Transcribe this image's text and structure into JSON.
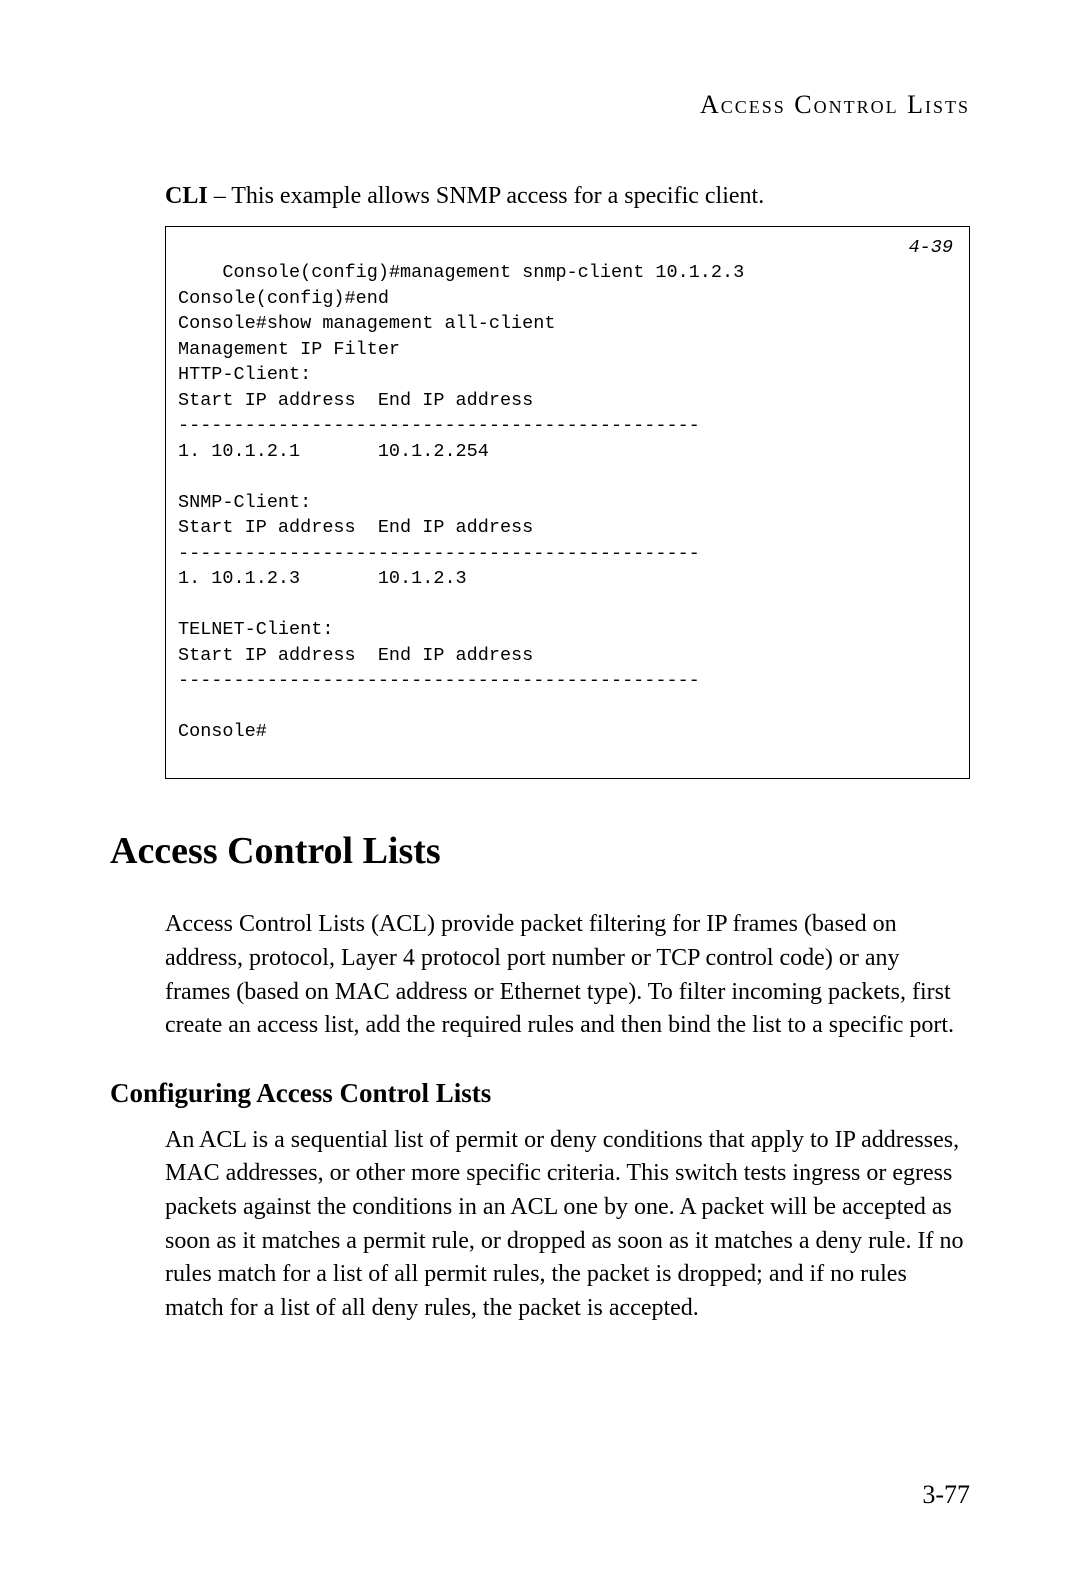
{
  "running_header": "Access Control Lists",
  "intro": {
    "label": "CLI",
    "text": " – This example allows SNMP access for a specific client."
  },
  "code_block": {
    "ref": "4-39",
    "text": "Console(config)#management snmp-client 10.1.2.3\nConsole(config)#end\nConsole#show management all-client\nManagement IP Filter\nHTTP-Client:\nStart IP address  End IP address\n-----------------------------------------------\n1. 10.1.2.1       10.1.2.254\n\nSNMP-Client:\nStart IP address  End IP address\n-----------------------------------------------\n1. 10.1.2.3       10.1.2.3\n\nTELNET-Client:\nStart IP address  End IP address\n-----------------------------------------------\n\nConsole#"
  },
  "section_heading": "Access Control Lists",
  "section_para": "Access Control Lists (ACL) provide packet filtering for IP frames (based on address, protocol, Layer 4 protocol port number or TCP control code) or any frames (based on MAC address or Ethernet type). To filter incoming packets, first create an access list, add the required rules and then bind the list to a specific port.",
  "sub_heading": "Configuring Access Control Lists",
  "sub_para": "An ACL is a sequential list of permit or deny conditions that apply to IP addresses, MAC addresses, or other more specific criteria. This switch tests ingress or egress packets against the conditions in an ACL one by one. A packet will be accepted as soon as it matches a permit rule, or dropped as soon as it matches a deny rule. If no rules match for a list of all permit rules, the packet is dropped; and if no rules match for a list of all deny rules, the packet is accepted.",
  "page_number": "3-77"
}
